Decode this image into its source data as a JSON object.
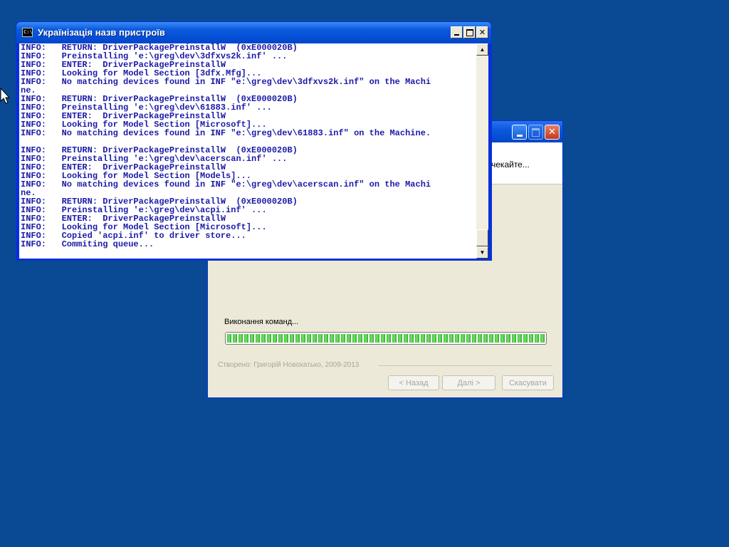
{
  "wizard": {
    "status_text": "чекайте...",
    "progress_label": "Виконання команд...",
    "progress_fraction": 1.0,
    "credit": "Створено: Григорій Новохатько, 2009-2013",
    "buttons": {
      "back": "< Назад",
      "next": "Далі >",
      "cancel": "Скасувати"
    }
  },
  "console": {
    "title": "Українізація назв пристроїв",
    "icon": "console-icon",
    "lines": [
      "INFO:   RETURN: DriverPackagePreinstallW  (0xE000020B)",
      "INFO:   Preinstalling 'e:\\greg\\dev\\3dfxvs2k.inf' ...",
      "INFO:   ENTER:  DriverPackagePreinstallW",
      "INFO:   Looking for Model Section [3dfx.Mfg]...",
      "INFO:   No matching devices found in INF \"e:\\greg\\dev\\3dfxvs2k.inf\" on the Machi",
      "ne.",
      "INFO:   RETURN: DriverPackagePreinstallW  (0xE000020B)",
      "INFO:   Preinstalling 'e:\\greg\\dev\\61883.inf' ...",
      "INFO:   ENTER:  DriverPackagePreinstallW",
      "INFO:   Looking for Model Section [Microsoft]...",
      "INFO:   No matching devices found in INF \"e:\\greg\\dev\\61883.inf\" on the Machine.",
      "",
      "INFO:   RETURN: DriverPackagePreinstallW  (0xE000020B)",
      "INFO:   Preinstalling 'e:\\greg\\dev\\acerscan.inf' ...",
      "INFO:   ENTER:  DriverPackagePreinstallW",
      "INFO:   Looking for Model Section [Models]...",
      "INFO:   No matching devices found in INF \"e:\\greg\\dev\\acerscan.inf\" on the Machi",
      "ne.",
      "INFO:   RETURN: DriverPackagePreinstallW  (0xE000020B)",
      "INFO:   Preinstalling 'e:\\greg\\dev\\acpi.inf' ...",
      "INFO:   ENTER:  DriverPackagePreinstallW",
      "INFO:   Looking for Model Section [Microsoft]...",
      "INFO:   Copied 'acpi.inf' to driver store...",
      "INFO:   Commiting queue..."
    ]
  }
}
